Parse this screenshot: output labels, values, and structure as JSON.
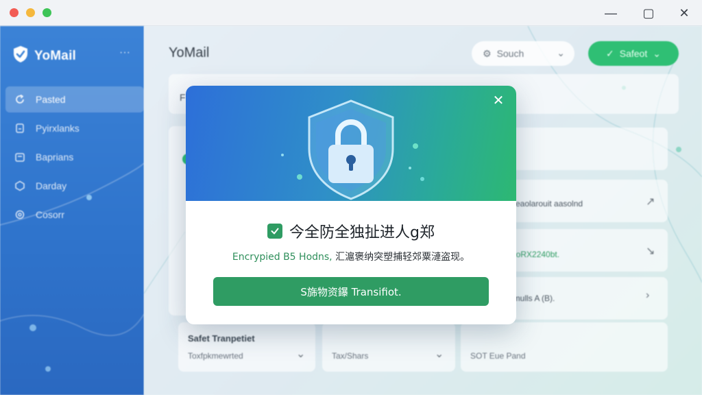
{
  "window": {
    "minimize_glyph": "—",
    "maximize_glyph": "▢",
    "close_glyph": "✕"
  },
  "sidebar": {
    "brand": "YoMail",
    "more": "···",
    "items": [
      {
        "label": "Pasted",
        "icon": "refresh-icon",
        "active": true
      },
      {
        "label": "Pyirxlanks",
        "icon": "document-icon",
        "active": false
      },
      {
        "label": "Baprians",
        "icon": "folder-icon",
        "active": false
      },
      {
        "label": "Darday",
        "icon": "hexagon-icon",
        "active": false
      },
      {
        "label": "Cosorr",
        "icon": "settings-icon",
        "active": false
      }
    ]
  },
  "main": {
    "title": "YoMail",
    "search_label": "Souch",
    "safe_button_label": "Safeot",
    "panel_letter": "F",
    "rows": [
      {
        "text": "",
        "arrow": ""
      },
      {
        "text": "",
        "arrow": ""
      },
      {
        "text": "meaolarouit aasolnd",
        "arrow": "↗"
      },
      {
        "text": "iXoRX2240bt.",
        "arrow": "↘"
      },
      {
        "text": "hmulls A (B).",
        "arrow": "›"
      }
    ],
    "bottom_cards": [
      {
        "title": "Safet Tranpetiet",
        "sub": "Toxfpkmewrted"
      },
      {
        "title": "",
        "sub": "Tax/Shars"
      },
      {
        "title": "",
        "sub": "SOT Eue Pand"
      }
    ]
  },
  "dialog": {
    "close": "✕",
    "heading": "今全防全独扯进人g郑",
    "desc_green": "Encrypied B5 Hodns,",
    "desc_rest": " 汇滬褒纳突塑捕轻郊粟漣盗现。",
    "action_label": "S旆物资鑤 Transifiot."
  },
  "colors": {
    "sidebar": "#3b82d6",
    "accent_green": "#2f9c63",
    "hero_start": "#2d6fd9",
    "hero_end": "#2db872"
  }
}
